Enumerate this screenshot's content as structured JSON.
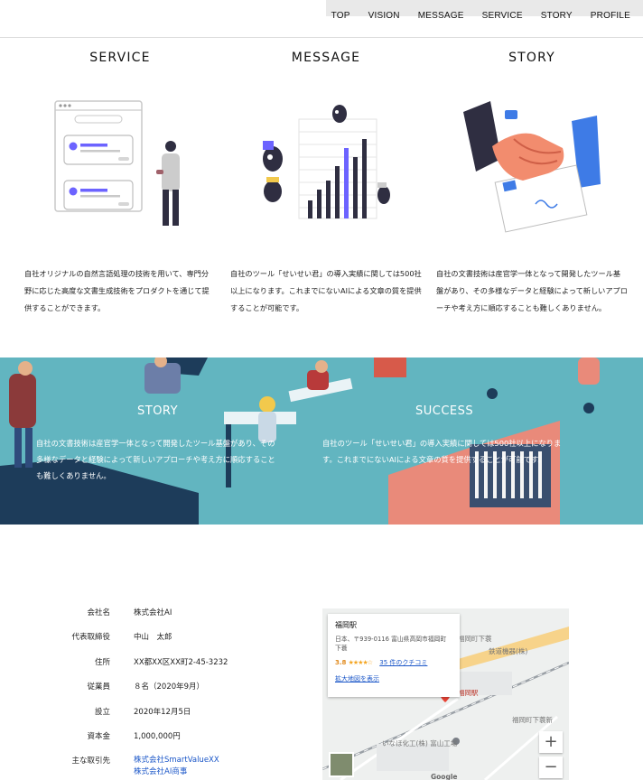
{
  "nav": {
    "items": [
      "TOP",
      "VISION",
      "MESSAGE",
      "SERVICE",
      "STORY",
      "PROFILE"
    ]
  },
  "columns": [
    {
      "title": "SERVICE",
      "text": "自社オリジナルの自然言語処理の技術を用いて、専門分野に応じた高度な文書生成技術をプロダクトを通じて提供することができます。"
    },
    {
      "title": "MESSAGE",
      "text": "自社のツール「せいせい君」の導入実績に関しては500社以上になります。これまでにないAIによる文章の質を提供することが可能です。"
    },
    {
      "title": "STORY",
      "text": "自社の文書技術は産官学一体となって開発したツール基盤があり、その多様なデータと経験によって新しいアプローチや考え方に順応することも難しくありません。"
    }
  ],
  "banner": {
    "left_title": "STORY",
    "left_text": "自社の文書技術は産官学一体となって開発したツール基盤があり、その多様なデータと経験によって新しいアプローチや考え方に順応することも難しくありません。",
    "right_title": "SUCCESS",
    "right_text": "自社のツール「せいせい君」の導入実績に関しては500社以上になります。これまでにないAIによる文章の質を提供することが可能です。"
  },
  "company": {
    "rows": [
      {
        "key": "会社名",
        "value": "株式会社AI"
      },
      {
        "key": "代表取締役",
        "value": "中山　太郎"
      },
      {
        "key": "住所",
        "value": "XX都XX区XX町2-45-3232"
      },
      {
        "key": "従業員",
        "value": "８名（2020年9月）"
      },
      {
        "key": "設立",
        "value": "2020年12月5日"
      },
      {
        "key": "資本金",
        "value": "1,000,000円"
      }
    ],
    "partners_key": "主な取引先",
    "partners": [
      "株式会社SmartValueXX",
      "株式会社AI商事"
    ]
  },
  "map": {
    "place": "福岡駅",
    "address": "日本、〒939-0116 富山県高岡市福岡町下蓑",
    "rating": "3.8",
    "stars": "★★★★☆",
    "reviews": "35 件のクチコミ",
    "enlarge": "拡大地図を表示",
    "labels": [
      "福岡町下蓑",
      "鉄道機器(株)",
      "福岡駅",
      "福岡町下蓑新",
      "いなほ化工(株) 富山工場",
      "Google"
    ],
    "zoom_in": "+",
    "zoom_out": "−",
    "colors": {
      "road": "#f7d38a",
      "rail": "#9aa0a6",
      "pin": "#ea4335"
    }
  }
}
